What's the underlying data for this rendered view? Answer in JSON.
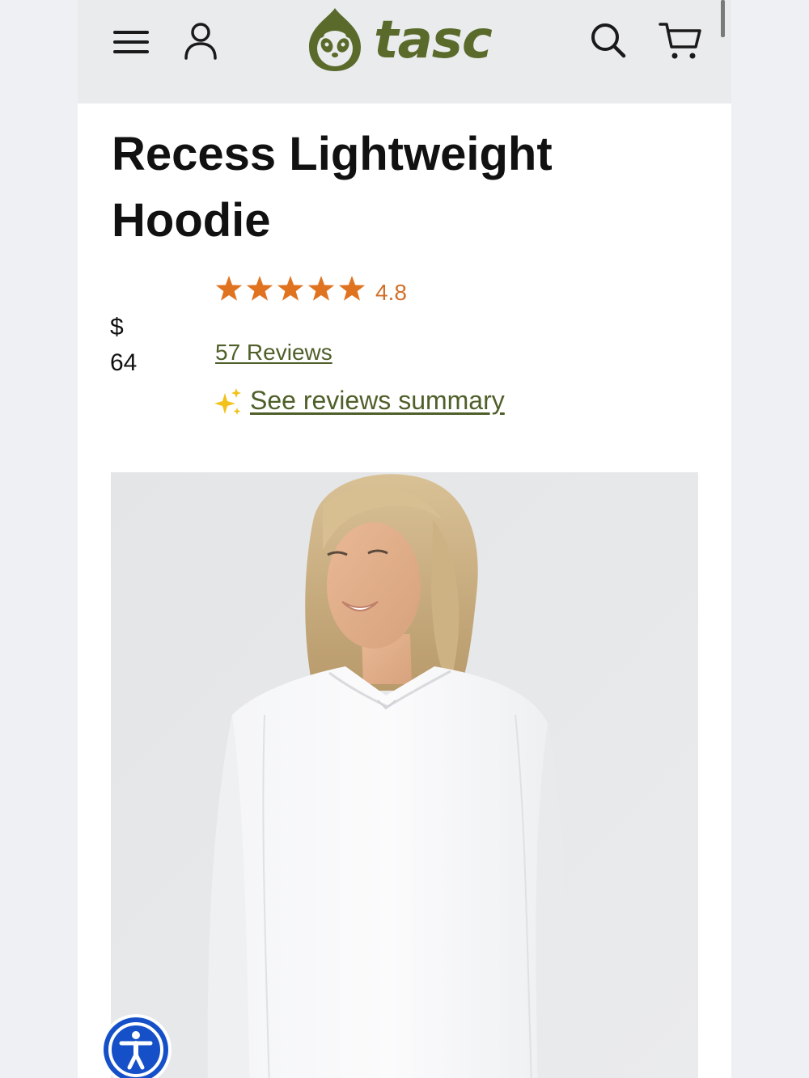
{
  "brand": {
    "name": "tasc",
    "color": "#5a6a2a"
  },
  "header": {
    "menu_icon": "hamburger-menu-icon",
    "account_icon": "user-account-icon",
    "search_icon": "search-icon",
    "cart_icon": "shopping-cart-icon"
  },
  "product": {
    "title": "Recess Lightweight Hoodie",
    "price_symbol": "$",
    "price_value": "64",
    "rating": {
      "value": "4.8",
      "stars_filled": 5,
      "stars_total": 5,
      "star_color": "#e0731f"
    },
    "reviews_link": "57 Reviews",
    "summary_link": "See reviews summary",
    "summary_icon": "sparkle-icon",
    "image_alt": "model-wearing-white-hoodie"
  },
  "accessibility": {
    "icon": "accessibility-icon",
    "color": "#1550c8"
  }
}
